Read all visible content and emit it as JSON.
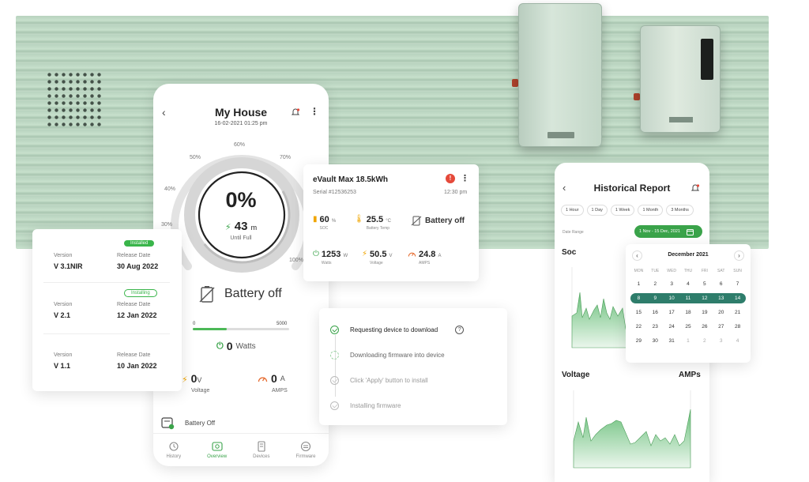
{
  "main_phone": {
    "title": "My House",
    "date": "16-02-2021 01:25 pm",
    "gauge_labels": [
      "0%",
      "30%",
      "40%",
      "50%",
      "60%",
      "70%",
      "100%"
    ],
    "percent": "0%",
    "minutes": "43",
    "minutes_unit": "m",
    "until_full": "Until Full",
    "battery_status": "Battery off",
    "range_min": "0",
    "range_max": "5000",
    "watts_value": "0",
    "watts_unit": "Watts",
    "voltage_value": "0",
    "voltage_unit": "V",
    "voltage_label": "Voltage",
    "amps_value": "0",
    "amps_unit": "A",
    "amps_label": "AMPS",
    "battery_off_row": "Battery Off",
    "nav": [
      {
        "label": "History",
        "icon": "history-icon"
      },
      {
        "label": "Overview",
        "icon": "eye-icon"
      },
      {
        "label": "Devices",
        "icon": "device-icon"
      },
      {
        "label": "Firmware",
        "icon": "firmware-icon"
      }
    ]
  },
  "versions": [
    {
      "badge": "Installed",
      "version_label": "Version",
      "version": "V 3.1NIR",
      "date_label": "Release Date",
      "date": "30 Aug 2022"
    },
    {
      "badge": "Installing",
      "version_label": "Version",
      "version": "V 2.1",
      "date_label": "Release Date",
      "date": "12 Jan 2022"
    },
    {
      "badge": "",
      "version_label": "Version",
      "version": "V 1.1",
      "date_label": "Release Date",
      "date": "10 Jan 2022"
    }
  ],
  "device_card": {
    "title": "eVault Max 18.5kWh",
    "alert": "!",
    "serial": "Serial  #12536253",
    "time": "12:30 pm",
    "soc_value": "60",
    "soc_unit": "%",
    "soc_label": "SOC",
    "temp_value": "25.5",
    "temp_unit": "°C",
    "temp_label": "Battery Temp",
    "status": "Battery off",
    "watts_value": "1253",
    "watts_unit": "W",
    "watts_label": "Watts",
    "voltage_value": "50.5",
    "voltage_unit": "V",
    "voltage_label": "Voltage",
    "amps_value": "24.8",
    "amps_unit": "A",
    "amps_label": "AMPS"
  },
  "firmware_steps": [
    {
      "label": "Requesting device to download",
      "state": "done"
    },
    {
      "label": "Downloading firmware into device",
      "state": "progress"
    },
    {
      "label": "Click 'Apply' button to install",
      "state": "pending"
    },
    {
      "label": "Installing firmware",
      "state": "pending"
    }
  ],
  "help_symbol": "?",
  "historical": {
    "title": "Historical Report",
    "tabs": [
      "1 Hour",
      "1 Day",
      "1 Week",
      "1 Month",
      "3 Months"
    ],
    "date_range_label": "Date Range",
    "date_range": "1 Nov - 15 Dec, 2021",
    "soc_title": "Soc",
    "voltage_title": "Voltage",
    "amps_title": "AMPs"
  },
  "calendar": {
    "month": "December 2021",
    "weekdays": [
      "MON",
      "TUE",
      "WED",
      "THU",
      "FRI",
      "SAT",
      "SUN"
    ],
    "days": [
      "1",
      "2",
      "3",
      "4",
      "5",
      "6",
      "7",
      "8",
      "9",
      "10",
      "11",
      "12",
      "13",
      "14",
      "15",
      "16",
      "17",
      "18",
      "19",
      "20",
      "21",
      "22",
      "23",
      "24",
      "25",
      "26",
      "27",
      "28",
      "29",
      "30",
      "31",
      "1",
      "2",
      "3",
      "4"
    ],
    "selected_range": [
      8,
      14
    ]
  },
  "colors": {
    "accent": "#3aa34a",
    "selected": "#2e7d6b",
    "alert": "#e5493a"
  }
}
